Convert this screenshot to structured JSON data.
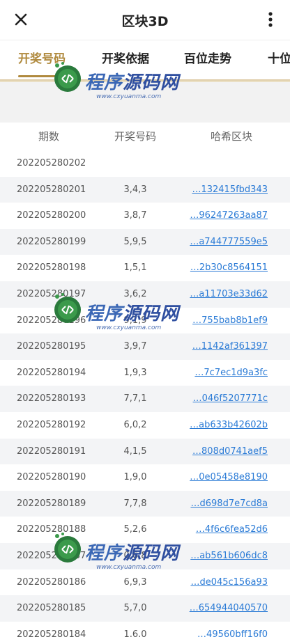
{
  "header": {
    "title": "区块3D"
  },
  "tabs": [
    {
      "label": "开奖号码",
      "active": true
    },
    {
      "label": "开奖依据",
      "active": false
    },
    {
      "label": "百位走势",
      "active": false
    },
    {
      "label": "十位",
      "active": false
    }
  ],
  "table": {
    "headers": [
      "期数",
      "开奖号码",
      "哈希区块"
    ],
    "rows": [
      {
        "period": "202205280202",
        "nums": "",
        "hash": ""
      },
      {
        "period": "202205280201",
        "nums": "3,4,3",
        "hash": "…132415fbd343"
      },
      {
        "period": "202205280200",
        "nums": "3,8,7",
        "hash": "…96247263aa87"
      },
      {
        "period": "202205280199",
        "nums": "5,9,5",
        "hash": "…a744777559e5"
      },
      {
        "period": "202205280198",
        "nums": "1,5,1",
        "hash": "…2b30c8564151"
      },
      {
        "period": "202205280197",
        "nums": "3,6,2",
        "hash": "…a11703e33d62"
      },
      {
        "period": "202205280196",
        "nums": "9,1,9",
        "hash": "…755bab8b1ef9"
      },
      {
        "period": "202205280195",
        "nums": "3,9,7",
        "hash": "…1142af361397"
      },
      {
        "period": "202205280194",
        "nums": "1,9,3",
        "hash": "…7c7ec1d9a3fc"
      },
      {
        "period": "202205280193",
        "nums": "7,7,1",
        "hash": "…046f5207771c"
      },
      {
        "period": "202205280192",
        "nums": "6,0,2",
        "hash": "…ab633b42602b"
      },
      {
        "period": "202205280191",
        "nums": "4,1,5",
        "hash": "…808d0741aef5"
      },
      {
        "period": "202205280190",
        "nums": "1,9,0",
        "hash": "…0e05458e8190"
      },
      {
        "period": "202205280189",
        "nums": "7,7,8",
        "hash": "…d698d7e7cd8a"
      },
      {
        "period": "202205280188",
        "nums": "5,2,6",
        "hash": "…4f6c6fea52d6"
      },
      {
        "period": "202205280187",
        "nums": "0,6,8",
        "hash": "…ab561b606dc8"
      },
      {
        "period": "202205280186",
        "nums": "6,9,3",
        "hash": "…de045c156a93"
      },
      {
        "period": "202205280185",
        "nums": "5,7,0",
        "hash": "…654944040570"
      },
      {
        "period": "202205280184",
        "nums": "1,6,0",
        "hash": "…49560bff16f0"
      }
    ]
  },
  "watermark": {
    "text_a": "程序",
    "text_b": "源码网",
    "url": "www.cxyuanma.com"
  },
  "colors": {
    "accent": "#b08a3e",
    "link": "#2b7bd6",
    "stripe": "#f3f4f6"
  },
  "icons": {
    "close": "close-icon",
    "more": "more-vertical-icon"
  }
}
